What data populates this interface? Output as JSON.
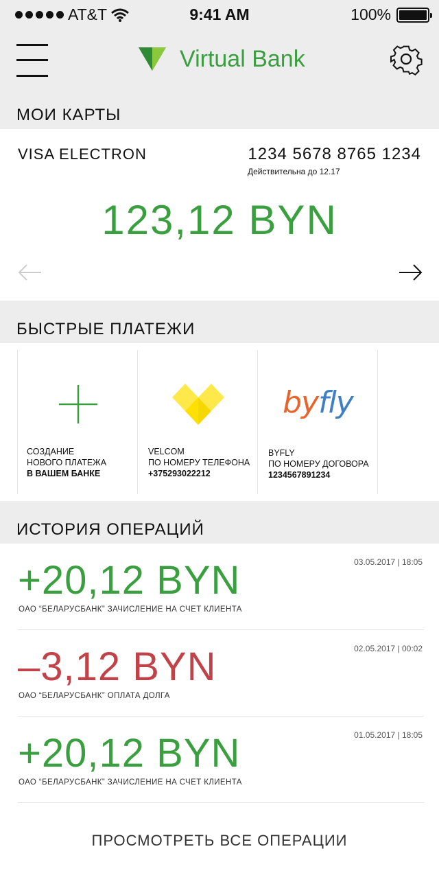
{
  "status_bar": {
    "carrier": "AT&T",
    "time": "9:41 AM",
    "battery": "100%"
  },
  "header": {
    "app_name_part1": "Virtual",
    "app_name_part2": " Bank",
    "brand_color": "#3a9f3f"
  },
  "cards_section": {
    "title": "МОИ КАРТЫ",
    "card": {
      "type": "VISA ELECTRON",
      "number": "1234 5678 8765 1234",
      "valid": "Действительна до 12.17",
      "balance": "123,12 BYN"
    }
  },
  "quick_payments": {
    "title": "БЫСТРЫЕ ПЛАТЕЖИ",
    "items": [
      {
        "icon": "plus-icon",
        "line1": "СОЗДАНИЕ",
        "line2": "НОВОГО ПЛАТЕЖА",
        "line3": "В ВАШЕМ БАНКЕ"
      },
      {
        "icon": "velcom-logo",
        "line1": "VELCOM",
        "line2": "ПО НОМЕРУ ТЕЛЕФОНА",
        "line3": "+375293022212"
      },
      {
        "icon": "byfly-logo",
        "logo_text_1": "by",
        "logo_text_2": "fly",
        "line1": "BYFLY",
        "line2": "ПО НОМЕРУ ДОГОВОРА",
        "line3": "1234567891234"
      }
    ]
  },
  "history": {
    "title": "ИСТОРИЯ ОПЕРАЦИЙ",
    "operations": [
      {
        "date": "03.05.2017 | 18:05",
        "amount": "+20,12 BYN",
        "desc": "ОАО “БЕЛАРУСБАНК” ЗАЧИСЛЕНИЕ НА СЧЕТ КЛИЕНТА"
      },
      {
        "date": "02.05.2017 | 00:02",
        "amount": "–3,12 BYN",
        "desc": "ОАО “БЕЛАРУСБАНК” ОПЛАТА ДОЛГА"
      },
      {
        "date": "01.05.2017 | 18:05",
        "amount": "+20,12 BYN",
        "desc": "ОАО “БЕЛАРУСБАНК” ЗАЧИСЛЕНИЕ НА СЧЕТ КЛИЕНТА"
      }
    ],
    "view_all": "ПРОСМОТРЕТЬ ВСЕ ОПЕРАЦИИ"
  },
  "colors": {
    "positive": "#3a9f3f",
    "negative": "#c0434a",
    "section_bg": "#ededed"
  }
}
